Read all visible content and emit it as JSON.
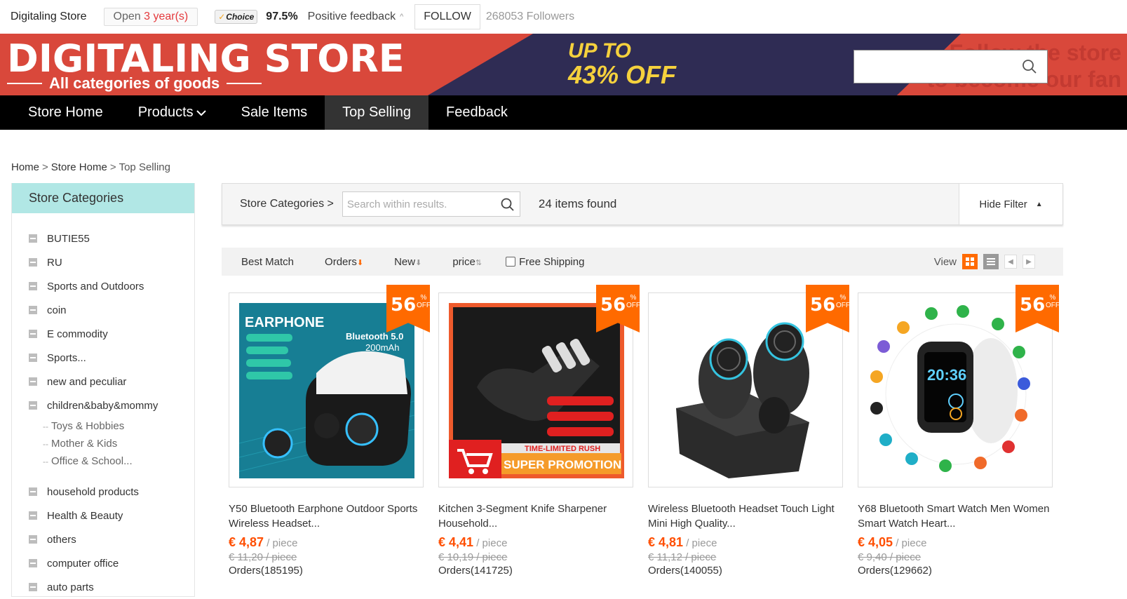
{
  "topbar": {
    "store_name": "Digitaling Store",
    "open_prefix": "Open ",
    "open_years": "3 year(s)",
    "choice_badge": "Choice",
    "rating": "97.5%",
    "feedback_label": "Positive feedback",
    "follow_label": "FOLLOW",
    "followers": "268053 Followers"
  },
  "banner": {
    "title": "DIGITALING STORE",
    "subtitle": "All categories of goods",
    "promo_line1": "UP TO",
    "promo_line2": "43% OFF",
    "fan_line1": "Follow the store",
    "fan_line2": "to become our fan"
  },
  "nav": {
    "items": [
      "Store Home",
      "Products",
      "Sale Items",
      "Top Selling",
      "Feedback"
    ],
    "active": "Top Selling"
  },
  "breadcrumb": {
    "home": "Home",
    "store_home": "Store Home",
    "current": "Top Selling"
  },
  "sidebar": {
    "title": "Store Categories",
    "categories": [
      "BUTIE55",
      "RU",
      "Sports and Outdoors",
      "coin",
      "E commodity",
      "Sports...",
      "new and peculiar",
      "children&baby&mommy",
      "household products",
      "Health & Beauty",
      "others",
      "computer office",
      "auto parts"
    ],
    "subcategories": [
      "Toys & Hobbies",
      "Mother & Kids",
      "Office & School..."
    ]
  },
  "filter": {
    "label": "Store Categories >",
    "search_placeholder": "Search within results.",
    "found": "24 items found",
    "hide_filter": "Hide Filter"
  },
  "sortbar": {
    "best_match": "Best Match",
    "orders": "Orders",
    "new": "New",
    "price": "price",
    "free_shipping": "Free Shipping",
    "view_label": "View"
  },
  "colors": {
    "accent_orange": "#ff6a00",
    "price_red": "#ff4e00",
    "banner_red": "#d9483b",
    "banner_navy": "#2f2c54",
    "category_header": "#b1e7e5"
  },
  "products": [
    {
      "discount": "56",
      "title": "Y50 Bluetooth Earphone Outdoor Sports Wireless Headset...",
      "price": "€ 4,87",
      "unit": " / piece",
      "old_price": "€ 11,20 / piece",
      "orders": "Orders(185195)",
      "image_text": {
        "heading": "EARPHONE",
        "spec1": "Bluetooth 5.0",
        "spec2": "200mAh"
      }
    },
    {
      "discount": "56",
      "title": "Kitchen 3-Segment Knife Sharpener Household...",
      "price": "€ 4,41",
      "unit": " / piece",
      "old_price": "€ 10,19 / piece",
      "orders": "Orders(141725)",
      "image_text": {
        "rush": "TIME-LIMITED RUSH",
        "promo": "SUPER PROMOTION"
      }
    },
    {
      "discount": "56",
      "title": "Wireless Bluetooth Headset Touch Light Mini High Quality...",
      "price": "€ 4,81",
      "unit": " / piece",
      "old_price": "€ 11,12 / piece",
      "orders": "Orders(140055)"
    },
    {
      "discount": "56",
      "title": "Y68 Bluetooth Smart Watch Men Women Smart Watch Heart...",
      "price": "€ 4,05",
      "unit": " / piece",
      "old_price": "€ 9,40 / piece",
      "orders": "Orders(129662)",
      "image_text": {
        "time": "20:36"
      }
    }
  ],
  "discount_unit": {
    "pct": "%",
    "off": "OFF"
  }
}
